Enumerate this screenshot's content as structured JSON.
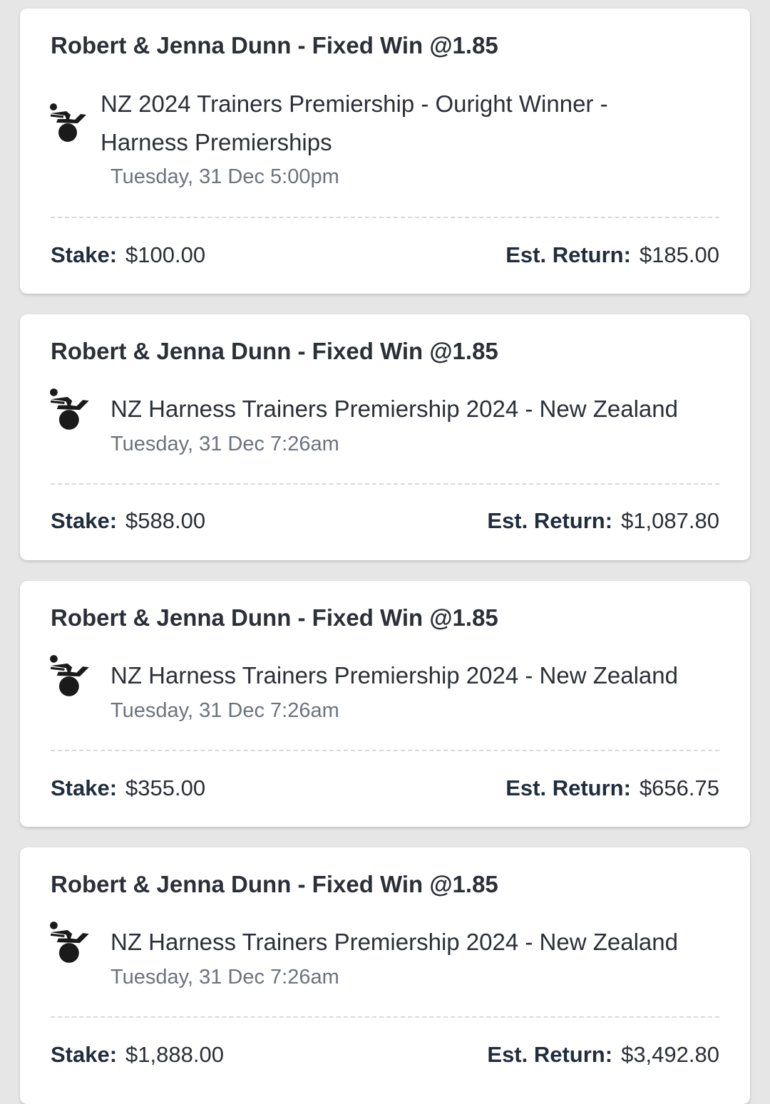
{
  "bets": [
    {
      "title": "Robert & Jenna Dunn - Fixed Win @1.85",
      "event_icon": "harness-racing-icon",
      "event_name_line1": "NZ 2024 Trainers Premiership - Ouright Winner -",
      "event_name_line2": "Harness Premierships",
      "event_time": "Tuesday, 31 Dec 5:00pm",
      "stake_label": "Stake:",
      "stake_value": "$100.00",
      "return_label": "Est. Return:",
      "return_value": "$185.00"
    },
    {
      "title": "Robert & Jenna Dunn - Fixed Win @1.85",
      "event_icon": "harness-racing-icon",
      "event_name": "NZ Harness Trainers Premiership 2024 - New Zealand",
      "event_time": "Tuesday, 31 Dec 7:26am",
      "stake_label": "Stake:",
      "stake_value": "$588.00",
      "return_label": "Est. Return:",
      "return_value": "$1,087.80"
    },
    {
      "title": "Robert & Jenna Dunn - Fixed Win @1.85",
      "event_icon": "harness-racing-icon",
      "event_name": "NZ Harness Trainers Premiership 2024 - New Zealand",
      "event_time": "Tuesday, 31 Dec 7:26am",
      "stake_label": "Stake:",
      "stake_value": "$355.00",
      "return_label": "Est. Return:",
      "return_value": "$656.75"
    },
    {
      "title": "Robert & Jenna Dunn - Fixed Win @1.85",
      "event_icon": "harness-racing-icon",
      "event_name": "NZ Harness Trainers Premiership 2024 - New Zealand",
      "event_time": "Tuesday, 31 Dec 7:26am",
      "stake_label": "Stake:",
      "stake_value": "$1,888.00",
      "return_label": "Est. Return:",
      "return_value": "$3,492.80"
    }
  ],
  "colors": {
    "background": "#e6e6e6",
    "card": "#ffffff",
    "text_primary": "#2b2f38",
    "text_secondary": "#6b7280",
    "label": "#1f2d3d",
    "icon": "#1a1a1a"
  }
}
